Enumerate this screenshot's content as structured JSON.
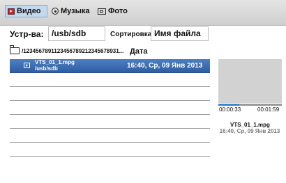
{
  "tabs": [
    {
      "label": "Видео",
      "icon": "video-icon",
      "active": true
    },
    {
      "label": "Музыка",
      "icon": "music-icon",
      "active": false
    },
    {
      "label": "Фото",
      "icon": "photo-icon",
      "active": false
    }
  ],
  "device": {
    "label": "Устр-ва:",
    "value": "/usb/sdb"
  },
  "sort": {
    "label": "Сортировка:",
    "value": "Имя файла"
  },
  "path": "/123456789112345678921234567893​1...",
  "columns": {
    "date": "Дата"
  },
  "files": [
    {
      "name": "VTS_01_1.mpg",
      "path": "/usb/sdb",
      "date": "16:40, Ср, 09 Янв 2013",
      "selected": true
    }
  ],
  "preview": {
    "progress": 0.33,
    "current_time": "00:00:33",
    "total_time": "00:01:59",
    "file_name": "VTS_01_1.mpg",
    "file_date": "16:40, Ср, 09 Янв 2013"
  },
  "colors": {
    "selection": "#3b6cb0",
    "progress": "#3f86d1",
    "tab_active": "#c2d9ef"
  }
}
